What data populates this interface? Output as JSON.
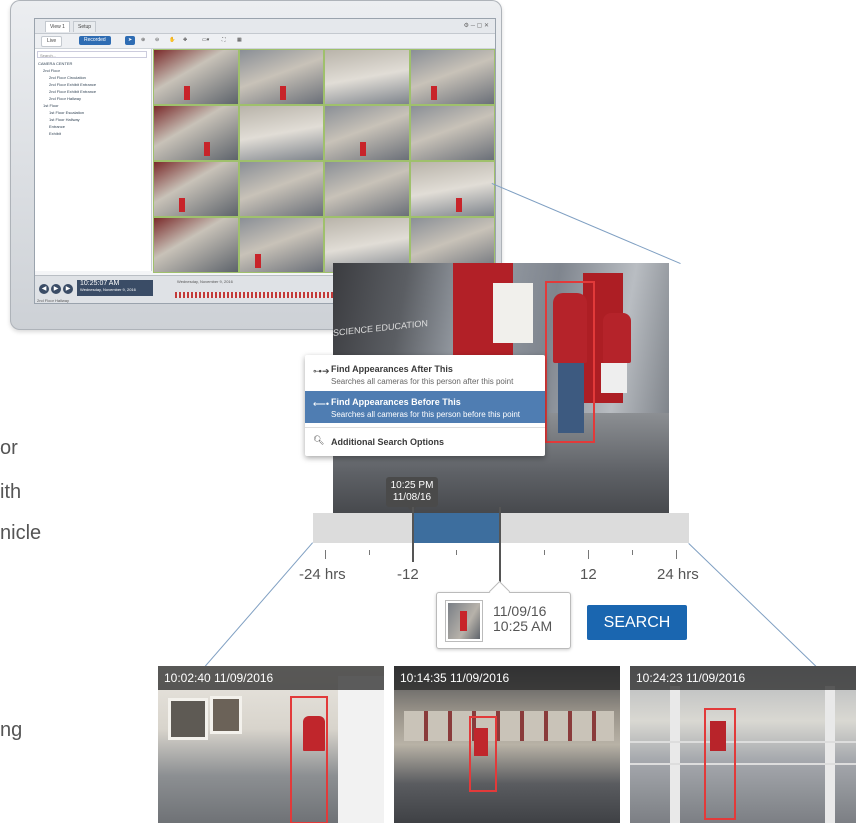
{
  "monitor": {
    "tabs": [
      "View 1",
      "Setup"
    ],
    "toolbar": {
      "live": "Live",
      "recorded": "Recorded"
    },
    "search_placeholder": "Search...",
    "tree": [
      "CAMERA CENTER",
      "2nd Floor",
      "2nd Floor Circulation",
      "2nd Floor Exhibit Entrance",
      "2nd Floor Exhibit Entrance",
      "2nd Floor Hallway",
      "1st Floor",
      "1st Floor Escalation",
      "1st Floor Hallway",
      "Entrance",
      "Exhibit"
    ],
    "timeline_time": "10:25:07 AM",
    "timeline_date": "Wednesday, November 9, 2016",
    "timeline_header": "Wednesday, November 9, 2016",
    "footer_label": "2nd Floor Hallway",
    "video_wall_text": "SCIENCE EDUCATION"
  },
  "context_menu": {
    "items": [
      {
        "title": "Find Appearances After This",
        "subtitle": "Searches all cameras for this person after this point",
        "icon": "arrow-right-icon"
      },
      {
        "title": "Find Appearances Before This",
        "subtitle": "Searches all cameras for this person before this point",
        "icon": "arrow-left-icon"
      },
      {
        "title": "Additional Search Options",
        "subtitle": "",
        "icon": "magnifier-icon"
      }
    ]
  },
  "tooltip": {
    "time": "10:25 PM",
    "date": "11/08/16"
  },
  "range": {
    "labels": [
      "-24 hrs",
      "-12",
      "12",
      "24 hrs"
    ]
  },
  "selected": {
    "date": "11/09/16",
    "time": "10:25 AM"
  },
  "search_button": "SEARCH",
  "results": [
    {
      "timestamp": "10:02:40  11/09/2016"
    },
    {
      "timestamp": "10:14:35  11/09/2016"
    },
    {
      "timestamp": "10:24:23  11/09/2016"
    }
  ],
  "left_text_fragments": [
    "or",
    "ith",
    "nicle",
    "ng"
  ],
  "colors": {
    "accent": "#1a66b0",
    "selection": "#3d6e9e",
    "box": "#e23a3a"
  }
}
